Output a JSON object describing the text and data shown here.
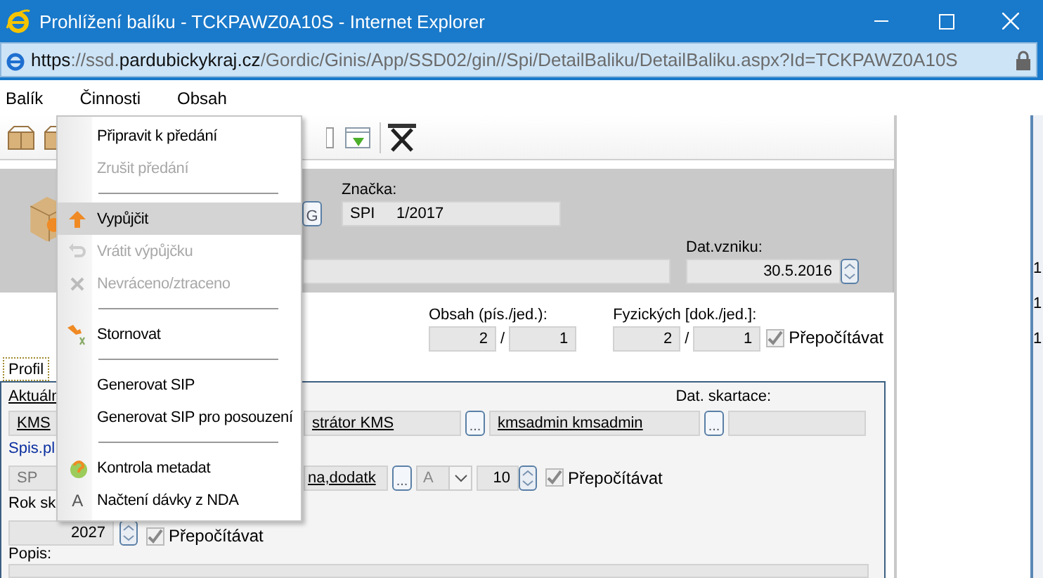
{
  "window": {
    "title": "Prohlížení balíku - TCKPAWZ0A10S - Internet Explorer"
  },
  "address": [
    {
      "text": "https",
      "strong": true
    },
    {
      "text": "://ssd.",
      "strong": false
    },
    {
      "text": "pardubickykraj.cz",
      "strong": true
    },
    {
      "text": "/Gordic/Ginis/App/SSD02/gin//Spi/DetailBaliku/DetailBaliku.aspx?Id=TCKPAWZ0A10S",
      "strong": false
    }
  ],
  "menubar": [
    "Balík",
    "Činnosti",
    "Obsah"
  ],
  "header": {
    "code_button": "G",
    "znacka_label": "Značka:",
    "znacka_value": "SPI     1/2017",
    "dat_vzniku_label": "Dat.vzniku:",
    "dat_vzniku_value": "30.5.2016"
  },
  "counts": {
    "obsah_label": "Obsah (pís./jed.):",
    "obsah": [
      "2",
      "1"
    ],
    "fyzickych_label": "Fyzických [dok./jed.]:",
    "fyzickych": [
      "2",
      "1"
    ],
    "slash": "/",
    "recalc": {
      "label": "Přepočítávat",
      "checked": true
    }
  },
  "tabs": [
    {
      "label": "Profil",
      "selected": true
    }
  ],
  "profile": {
    "aktualni_label": "Aktuáln",
    "skartace_label": "Dat. skartace:",
    "kms": "KMS",
    "spravce": "strátor KMS",
    "more": "...",
    "user": "kmsadmin kmsadmin",
    "spis_label": "Spis.pl",
    "sp": "SP",
    "znak": "na,dodatk",
    "mode": "A",
    "lhuta": "10",
    "recalc1": {
      "label": "Přepočítávat",
      "checked": true
    },
    "rok_label": "Rok sk",
    "rok": "2027",
    "recalc2": {
      "label": "Přepočítávat",
      "checked": true
    },
    "popis_label": "Popis:"
  },
  "context_menu": [
    {
      "kind": "item",
      "label": "Připravit k předání",
      "disabled": false,
      "selected": false
    },
    {
      "kind": "item",
      "label": "Zrušit předání",
      "disabled": true,
      "selected": false
    },
    {
      "kind": "separator"
    },
    {
      "kind": "item",
      "label": "Vypůjčit",
      "disabled": false,
      "selected": true
    },
    {
      "kind": "item",
      "label": "Vrátit výpůjčku",
      "disabled": true,
      "selected": false
    },
    {
      "kind": "item",
      "label": "Nevráceno/ztraceno",
      "disabled": true,
      "selected": false
    },
    {
      "kind": "separator"
    },
    {
      "kind": "item",
      "label": "Stornovat",
      "disabled": false,
      "selected": false
    },
    {
      "kind": "separator"
    },
    {
      "kind": "item",
      "label": "Generovat SIP",
      "disabled": false,
      "selected": false
    },
    {
      "kind": "item",
      "label": "Generovat SIP pro posouzení",
      "disabled": false,
      "selected": false
    },
    {
      "kind": "separator"
    },
    {
      "kind": "item",
      "label": "Kontrola metadat",
      "disabled": false,
      "selected": false
    },
    {
      "kind": "item",
      "label": "Načtení dávky z NDA",
      "disabled": false,
      "selected": false,
      "glyph": "A"
    }
  ],
  "right_strip": [
    "1",
    "1",
    "1"
  ]
}
